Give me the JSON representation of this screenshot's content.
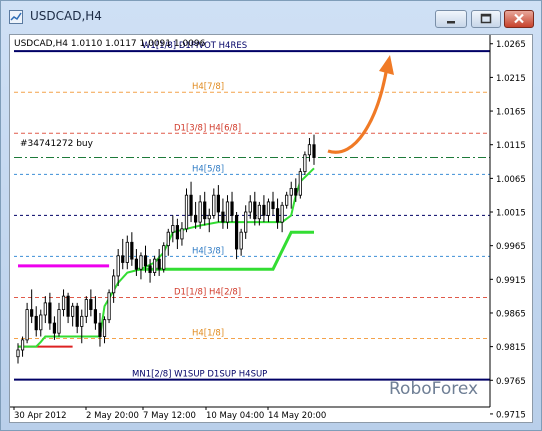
{
  "window": {
    "title": "USDCAD,H4",
    "controls": {
      "minimize_icon": "minimize-icon",
      "maximize_icon": "maximize-icon",
      "close_icon": "close-icon"
    }
  },
  "header": {
    "symbol_line": "USDCAD,H4  1.0110 1.0117 1.0091 1.0096",
    "order_label": "#34741272 buy"
  },
  "watermark": "RoboForex",
  "colors": {
    "candle": "#000000",
    "green_line": "#33dd33",
    "red_line": "#dd2222",
    "magenta_line": "#ee00ee",
    "navy_line": "#000066",
    "orange_line": "#f4a24a",
    "red_dash": "#e05a4a",
    "blue_dash": "#3d8fd6",
    "arrow": "#f07a26",
    "price_box_dark": "#000066",
    "price_box_blue": "#42a3e6",
    "price_box_orange": "#f6a31c",
    "price_box_red": "#e4402a"
  },
  "chart_data": {
    "type": "candlestick",
    "price_axis_ticks": [
      "1.0265",
      "1.0215",
      "1.0165",
      "1.0115",
      "1.0065",
      "1.0015",
      "0.9965",
      "0.9915",
      "0.9865",
      "0.9815",
      "0.9765",
      "0.9715"
    ],
    "time_axis_labels": [
      "30 Apr 2012",
      "2 May 20:00",
      "7 May 12:00",
      "10 May 04:00",
      "14 May 20:00"
    ],
    "levels": [
      {
        "label": "W1[1/8] D1PIVOT H4RES",
        "price": 1.0254,
        "price_label": "1.0254",
        "style": "navy"
      },
      {
        "label": "H4[7/8]",
        "price": 1.0193,
        "price_label": "1.0193",
        "style": "orange"
      },
      {
        "label": "D1[3/8] H4[6/8]",
        "price": 1.0132,
        "price_label": "1.0132",
        "style": "red"
      },
      {
        "label": "",
        "price": 1.0096,
        "price_label": "1.0096",
        "style": "current"
      },
      {
        "label": "H4[5/8]",
        "price": 1.0071,
        "price_label": "1.0071",
        "style": "blue"
      },
      {
        "label": "",
        "price": 1.001,
        "price_label": "1.0010",
        "style": "order"
      },
      {
        "label": "H4[3/8]",
        "price": 0.9949,
        "price_label": "0.9949",
        "style": "blue"
      },
      {
        "label": "D1[1/8] H4[2/8]",
        "price": 0.9888,
        "price_label": "0.9888",
        "style": "red"
      },
      {
        "label": "H4[1/8]",
        "price": 0.9827,
        "price_label": "0.9827",
        "style": "orange"
      },
      {
        "label": "MN1[2/8] W1SUP D1SUP H4SUP",
        "price": 0.9766,
        "price_label": "0.9766",
        "style": "navy"
      }
    ],
    "ohlc": [
      [
        0.98,
        0.982,
        0.979,
        0.981
      ],
      [
        0.981,
        0.983,
        0.98,
        0.9825
      ],
      [
        0.9825,
        0.988,
        0.982,
        0.987
      ],
      [
        0.987,
        0.99,
        0.985,
        0.986
      ],
      [
        0.986,
        0.9875,
        0.983,
        0.984
      ],
      [
        0.984,
        0.987,
        0.983,
        0.9862
      ],
      [
        0.9862,
        0.989,
        0.985,
        0.988
      ],
      [
        0.988,
        0.9895,
        0.984,
        0.985
      ],
      [
        0.985,
        0.986,
        0.9825,
        0.9835
      ],
      [
        0.9835,
        0.988,
        0.983,
        0.987
      ],
      [
        0.987,
        0.99,
        0.986,
        0.989
      ],
      [
        0.989,
        0.9895,
        0.985,
        0.986
      ],
      [
        0.986,
        0.988,
        0.9845,
        0.9875
      ],
      [
        0.9875,
        0.988,
        0.9835,
        0.9845
      ],
      [
        0.9845,
        0.987,
        0.982,
        0.986
      ],
      [
        0.986,
        0.989,
        0.985,
        0.9885
      ],
      [
        0.9885,
        0.99,
        0.986,
        0.987
      ],
      [
        0.987,
        0.989,
        0.984,
        0.985
      ],
      [
        0.985,
        0.9865,
        0.9815,
        0.983
      ],
      [
        0.983,
        0.986,
        0.982,
        0.9855
      ],
      [
        0.9855,
        0.99,
        0.985,
        0.9895
      ],
      [
        0.9895,
        0.993,
        0.988,
        0.992
      ],
      [
        0.992,
        0.996,
        0.9905,
        0.995
      ],
      [
        0.995,
        0.9975,
        0.993,
        0.994
      ],
      [
        0.994,
        0.998,
        0.993,
        0.997
      ],
      [
        0.997,
        0.9985,
        0.9935,
        0.9945
      ],
      [
        0.9945,
        0.996,
        0.992,
        0.993
      ],
      [
        0.993,
        0.9955,
        0.9915,
        0.995
      ],
      [
        0.995,
        0.9965,
        0.9925,
        0.9935
      ],
      [
        0.9935,
        0.9945,
        0.991,
        0.9925
      ],
      [
        0.9925,
        0.995,
        0.992,
        0.9945
      ],
      [
        0.9945,
        0.996,
        0.992,
        0.993
      ],
      [
        0.993,
        0.997,
        0.9925,
        0.9965
      ],
      [
        0.9965,
        0.999,
        0.995,
        0.9985
      ],
      [
        0.9985,
        1.001,
        0.997,
        0.9995
      ],
      [
        0.9995,
        1.0005,
        0.996,
        0.9975
      ],
      [
        0.9975,
        1.0,
        0.9965,
        0.999
      ],
      [
        0.999,
        1.005,
        0.9985,
        1.004
      ],
      [
        1.004,
        1.006,
        1.0,
        1.001
      ],
      [
        1.001,
        1.003,
        0.999,
        1.0
      ],
      [
        1.0,
        1.004,
        0.999,
        1.003
      ],
      [
        1.003,
        1.0045,
        0.9995,
        1.0005
      ],
      [
        1.0005,
        1.002,
        0.9985,
        1.001
      ],
      [
        1.001,
        1.005,
        1.0005,
        1.004
      ],
      [
        1.004,
        1.0055,
        1.0,
        1.0015
      ],
      [
        1.0015,
        1.0035,
        0.999,
        1.0
      ],
      [
        1.0,
        1.004,
        0.999,
        1.003
      ],
      [
        1.003,
        1.0045,
        1.0,
        1.001
      ],
      [
        1.001,
        1.0015,
        0.9945,
        0.996
      ],
      [
        0.996,
        0.999,
        0.995,
        0.9985
      ],
      [
        0.9985,
        1.0025,
        0.9975,
        1.0015
      ],
      [
        1.0015,
        1.004,
        1.0005,
        1.003
      ],
      [
        1.003,
        1.0045,
        0.9995,
        1.0005
      ],
      [
        1.0005,
        1.003,
        0.9995,
        1.0025
      ],
      [
        1.0025,
        1.004,
        1.0,
        1.001
      ],
      [
        1.001,
        1.0035,
        1.0,
        1.003
      ],
      [
        1.003,
        1.0045,
        1.001,
        1.002
      ],
      [
        1.002,
        1.0035,
        0.999,
        1.0
      ],
      [
        1.0,
        1.003,
        0.9985,
        1.0025
      ],
      [
        1.0025,
        1.0045,
        1.002,
        1.004
      ],
      [
        1.004,
        1.006,
        1.002,
        1.005
      ],
      [
        1.005,
        1.0065,
        1.003,
        1.004
      ],
      [
        1.004,
        1.008,
        1.0035,
        1.0075
      ],
      [
        1.0075,
        1.0105,
        1.007,
        1.01
      ],
      [
        1.01,
        1.0125,
        1.009,
        1.0115
      ],
      [
        1.0115,
        1.013,
        1.0085,
        1.0096
      ]
    ],
    "green_trail_upper": [
      [
        0,
        0.9815
      ],
      [
        4,
        0.9815
      ],
      [
        5,
        0.9822
      ],
      [
        6,
        0.983
      ],
      [
        18,
        0.983
      ],
      [
        19,
        0.9875
      ],
      [
        22,
        0.991
      ],
      [
        24,
        0.9925
      ],
      [
        27,
        0.993
      ],
      [
        30,
        0.994
      ],
      [
        32,
        0.9955
      ],
      [
        34,
        0.9985
      ],
      [
        40,
        0.9995
      ],
      [
        44,
        1.0
      ],
      [
        58,
        1.0
      ],
      [
        60,
        1.001
      ],
      [
        61,
        1.004
      ],
      [
        62,
        1.006
      ],
      [
        65,
        1.008
      ]
    ],
    "red_trail": [
      [
        0,
        0.9815
      ],
      [
        4,
        0.9815
      ],
      [
        12,
        0.9815
      ]
    ],
    "magenta_line": [
      [
        0,
        0.9935
      ],
      [
        20,
        0.9935
      ]
    ],
    "green_trail_lower": [
      [
        26,
        0.993
      ],
      [
        56,
        0.993
      ],
      [
        60,
        0.9985
      ],
      [
        65,
        0.9985
      ]
    ]
  }
}
